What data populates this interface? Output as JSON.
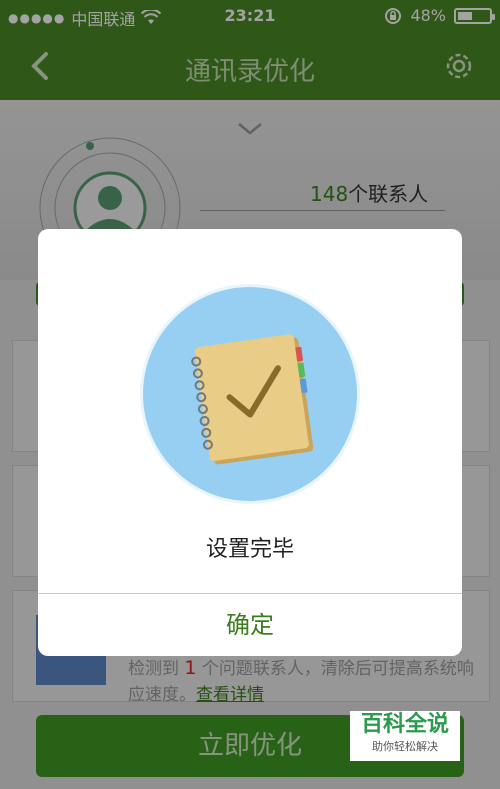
{
  "status_bar": {
    "carrier": "中国联通",
    "time": "23:21",
    "battery": "48%",
    "battery_level": 0.48
  },
  "nav": {
    "title": "通讯录优化",
    "back_icon": "chevron-left-icon",
    "settings_icon": "gear-icon"
  },
  "summary": {
    "contact_count": "148",
    "contact_suffix": "个联系人"
  },
  "issue": {
    "prefix": "检测到",
    "count": "1",
    "middle": "个问题联系人，清除后可提高系统响应速度。",
    "link": "查看详情"
  },
  "optimize_button": "立即优化",
  "dialog": {
    "message": "设置完毕",
    "confirm": "确定"
  },
  "watermark": {
    "title": "百科全说",
    "subtitle": "助你轻松解决"
  },
  "colors": {
    "brand_green": "#4a8a26",
    "confirm_green": "#3d7d1f",
    "circle_blue": "#97cff3"
  }
}
